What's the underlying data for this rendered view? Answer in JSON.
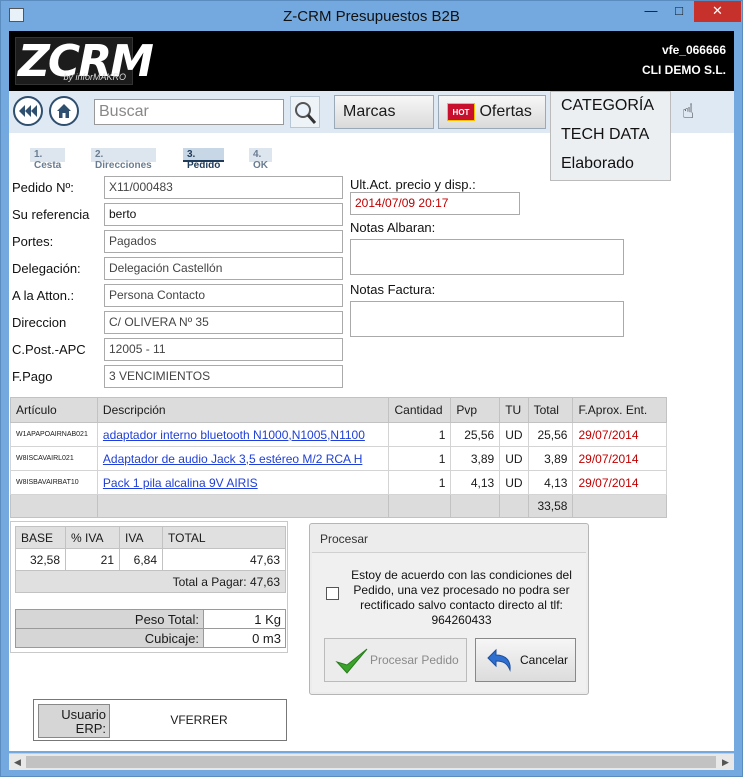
{
  "window": {
    "title": "Z-CRM Presupuestos B2B"
  },
  "header": {
    "logo_text": "ZCRM",
    "logo_sub": "by inforMAKRO",
    "user_code": "vfe_066666",
    "client_name": "CLI DEMO S.L."
  },
  "toolbar": {
    "search_placeholder": "Buscar",
    "marcas_label": "Marcas",
    "ofertas_label": "Ofertas",
    "hot_badge": "HOT",
    "categoria_label": "CATEGORÍA",
    "dropdown_items": [
      "TECH DATA",
      "Elaborado"
    ]
  },
  "steps": [
    "1. Cesta",
    "2. Direcciones",
    "3. Pedido",
    "4. OK"
  ],
  "order": {
    "pedido_label": "Pedido Nº:",
    "pedido_value": "X11/000483",
    "referencia_label": "Su referencia",
    "referencia_value": "berto",
    "portes_label": "Portes:",
    "portes_value": "Pagados",
    "delegacion_label": "Delegación:",
    "delegacion_value": "Delegación Castellón",
    "atton_label": "A la Atton.:",
    "atton_value": "Persona Contacto",
    "direccion_label": "Direccion",
    "direccion_value": "C/ OLIVERA Nº 35",
    "cpost_label": "C.Post.-APC",
    "cpost_value": "12005 - 11",
    "fpago_label": "F.Pago",
    "fpago_value": "3 VENCIMIENTOS"
  },
  "right": {
    "ultact_label": "Ult.Act. precio y disp.:",
    "ultact_value": "2014/07/09  20:17",
    "albaran_label": "Notas Albaran:",
    "factura_label": "Notas Factura:"
  },
  "grid": {
    "headers": [
      "Artículo",
      "Descripción",
      "Cantidad",
      "Pvp",
      "TU",
      "Total",
      "F.Aprox. Ent."
    ],
    "rows": [
      {
        "codigo": "W1APAPOAIRNAB021",
        "descripcion": "adaptador interno bluetooth N1000,N1005,N1100",
        "cantidad": "1",
        "pvp": "25,56",
        "tu": "UD",
        "total": "25,56",
        "fecha": "29/07/2014"
      },
      {
        "codigo": "W8ISCAVAIRL021",
        "descripcion": "Adaptador de audio Jack 3,5 estéreo M/2 RCA H",
        "cantidad": "1",
        "pvp": "3,89",
        "tu": "UD",
        "total": "3,89",
        "fecha": "29/07/2014"
      },
      {
        "codigo": "W8ISBAVAIRBAT10",
        "descripcion": "Pack 1 pila alcalina 9V AIRIS",
        "cantidad": "1",
        "pvp": "4,13",
        "tu": "UD",
        "total": "4,13",
        "fecha": "29/07/2014"
      }
    ],
    "footer_total": "33,58"
  },
  "iva": {
    "headers": [
      "BASE",
      "% IVA",
      "IVA",
      "TOTAL"
    ],
    "base": "32,58",
    "pct": "21",
    "iva": "6,84",
    "total": "47,63",
    "pagar": "Total a Pagar: 47,63"
  },
  "weights": {
    "peso_label": "Peso Total:",
    "peso_value": "1 Kg",
    "cubicaje_label": "Cubicaje:",
    "cubicaje_value": "0 m3"
  },
  "procesar": {
    "title": "Procesar",
    "text": "Estoy de acuerdo con las condiciones del Pedido, una vez procesado no podra ser rectificado salvo contacto directo al tlf: 964260433",
    "procesar_label": "Procesar Pedido",
    "cancelar_label": "Cancelar"
  },
  "usuario": {
    "label": "Usuario ERP:",
    "value": "VFERRER"
  },
  "colors": {
    "titlebar": "#73a9de",
    "header": "#000000",
    "link": "#1f3fd6",
    "date_red": "#c00000",
    "ok_green": "#3aa32a",
    "hot_red": "#c8102e"
  }
}
